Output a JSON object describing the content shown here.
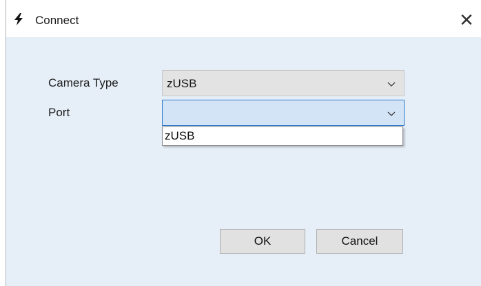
{
  "window": {
    "title": "Connect",
    "title_icon": "lightning-bolt-icon",
    "close_label": "✕"
  },
  "form": {
    "camera_type_label": "Camera Type",
    "camera_type_value": "zUSB",
    "port_label": "Port",
    "port_value": "",
    "port_options": [
      "zUSB"
    ]
  },
  "buttons": {
    "ok_label": "OK",
    "cancel_label": "Cancel"
  },
  "colors": {
    "client_bg": "#e6eef7",
    "focus_border": "#2a78c8",
    "focus_bg": "#d2e4f6"
  }
}
